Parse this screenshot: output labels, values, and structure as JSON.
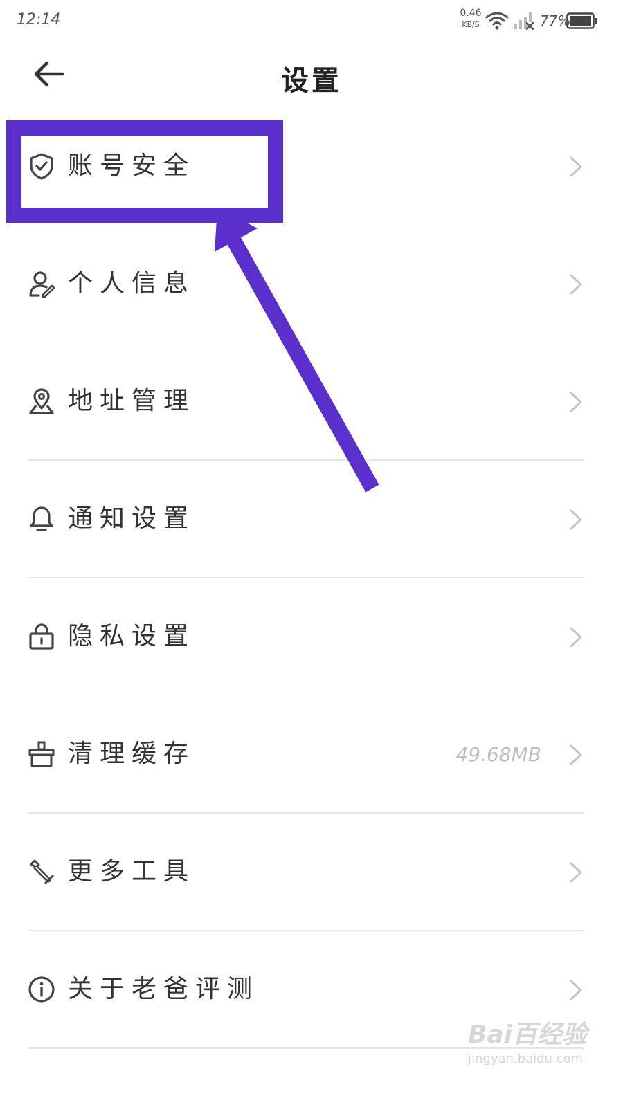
{
  "status_bar": {
    "time": "12:14",
    "net_speed_value": "0.46",
    "net_speed_unit": "KB/S",
    "battery_percent": "77%",
    "icons": [
      "wifi-icon",
      "signal-icon",
      "battery-icon"
    ]
  },
  "header": {
    "title": "设置",
    "back_icon": "arrow-left-icon"
  },
  "settings": {
    "items": [
      {
        "label": "账号安全",
        "icon": "shield-check-icon"
      },
      {
        "label": "个人信息",
        "icon": "user-edit-icon"
      },
      {
        "label": "地址管理",
        "icon": "location-pin-icon"
      },
      {
        "label": "通知设置",
        "icon": "bell-icon"
      },
      {
        "label": "隐私设置",
        "icon": "lock-icon"
      },
      {
        "label": "清理缓存",
        "icon": "broom-icon",
        "value": "49.68MB"
      },
      {
        "label": "更多工具",
        "icon": "wrench-icon"
      },
      {
        "label": "关于老爸评测",
        "icon": "info-icon"
      }
    ]
  },
  "annotation": {
    "color": "#5a2fcc",
    "highlights": "settings.items.0"
  },
  "watermark": {
    "logo": "Bai百经验",
    "url": "jingyan.baidu.com"
  }
}
